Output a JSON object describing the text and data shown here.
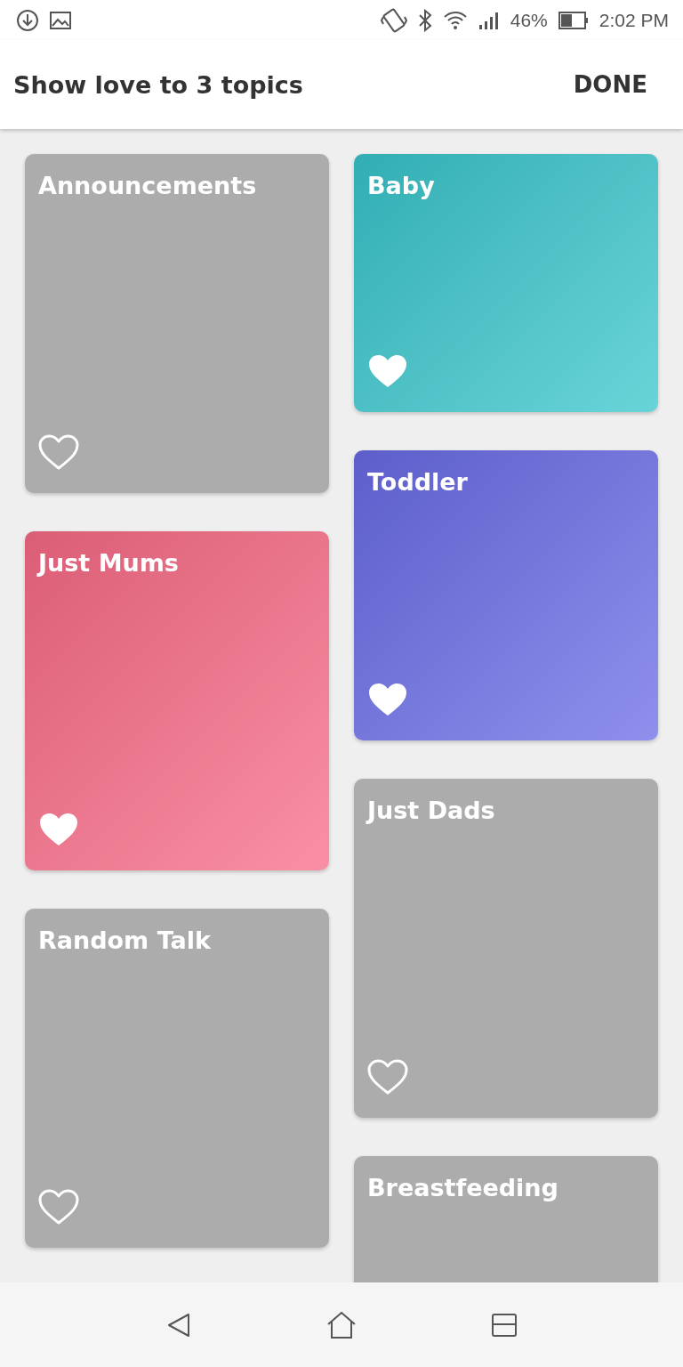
{
  "status_bar": {
    "battery": "46%",
    "time": "2:02 PM"
  },
  "header": {
    "title": "Show love to 3 topics",
    "action": "DONE"
  },
  "columns": [
    {
      "topics": [
        {
          "name": "Announcements",
          "loved": false
        },
        {
          "name": "Just Mums",
          "loved": true,
          "color": "#f86a86"
        },
        {
          "name": "Random Talk",
          "loved": false
        }
      ]
    },
    {
      "topics": [
        {
          "name": "Baby",
          "loved": true,
          "color": "#36c6cc"
        },
        {
          "name": "Toddler",
          "loved": true,
          "color": "#6a6be6"
        },
        {
          "name": "Just Dads",
          "loved": false
        },
        {
          "name": "Breastfeeding"
        }
      ]
    }
  ]
}
